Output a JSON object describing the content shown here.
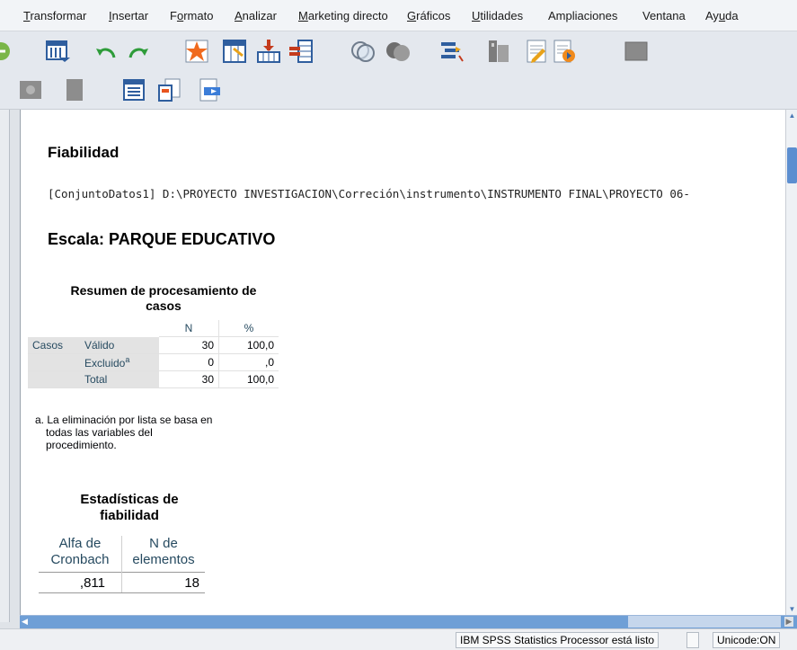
{
  "menu": [
    {
      "pre": "",
      "u": "T",
      "post": "ransformar"
    },
    {
      "pre": "",
      "u": "I",
      "post": "nsertar"
    },
    {
      "pre": "F",
      "u": "o",
      "post": "rmato"
    },
    {
      "pre": "",
      "u": "A",
      "post": "nalizar"
    },
    {
      "pre": "",
      "u": "M",
      "post": "arketing directo"
    },
    {
      "pre": "",
      "u": "G",
      "post": "ráficos"
    },
    {
      "pre": "",
      "u": "U",
      "post": "tilidades"
    },
    {
      "pre": "Ampliaciones",
      "u": "",
      "post": ""
    },
    {
      "pre": "Ventana",
      "u": "",
      "post": ""
    },
    {
      "pre": "Ay",
      "u": "u",
      "post": "da"
    }
  ],
  "icons": {
    "toolbar1": [
      "recall-icon",
      "data-view-icon",
      "undo-icon",
      "redo-icon",
      "goto-case-icon",
      "goto-variable-icon",
      "insert-cases-icon",
      "insert-variable-icon",
      "split-file-icon",
      "weight-cases-icon",
      "select-cases-icon",
      "value-labels-icon",
      "use-sets-icon",
      "spell-check-icon",
      "script-icon"
    ],
    "toolbar2": [
      "designate-window-icon",
      "collapse-icon",
      "show-all-icon",
      "insert-heading-icon",
      "insert-text-icon"
    ]
  },
  "output": {
    "title": "Fiabilidad",
    "path": "[ConjuntoDatos1] D:\\PROYECTO INVESTIGACION\\Correción\\instrumento\\INSTRUMENTO FINAL\\PROYECTO 06-",
    "scale": "Escala: PARQUE EDUCATIVO"
  },
  "summary_table": {
    "title_line1": "Resumen de procesamiento de",
    "title_line2": "casos",
    "col_n": "N",
    "col_pct": "%",
    "group": "Casos",
    "rows": [
      {
        "label": "Válido",
        "sup": "",
        "n": "30",
        "pct": "100,0"
      },
      {
        "label": "Excluido",
        "sup": "a",
        "n": "0",
        "pct": ",0"
      },
      {
        "label": "Total",
        "sup": "",
        "n": "30",
        "pct": "100,0"
      }
    ],
    "footnote_l1": "a. La eliminación por lista se basa en",
    "footnote_l2": "todas las variables del",
    "footnote_l3": "procedimiento."
  },
  "reliability_table": {
    "title_line1": "Estadísticas de",
    "title_line2": "fiabilidad",
    "col1_l1": "Alfa de",
    "col1_l2": "Cronbach",
    "col2_l1": "N de",
    "col2_l2": "elementos",
    "alpha": ",811",
    "n_items": "18"
  },
  "status": {
    "processor": "IBM SPSS Statistics Processor está listo",
    "unicode": "Unicode:ON"
  }
}
